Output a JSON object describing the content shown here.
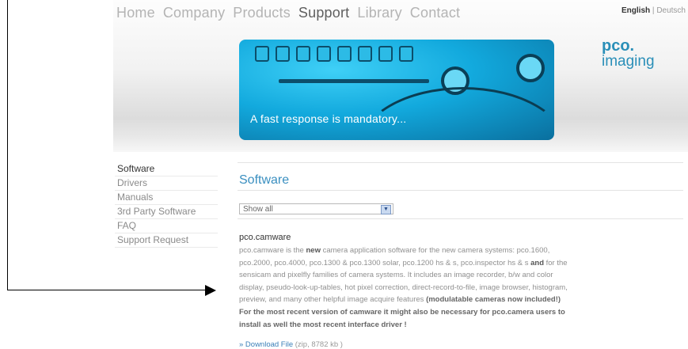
{
  "nav": {
    "items": [
      "Home",
      "Company",
      "Products",
      "Support",
      "Library",
      "Contact"
    ],
    "active": "Support"
  },
  "lang": {
    "english": "English",
    "separator": "|",
    "deutsch": "Deutsch"
  },
  "logo": {
    "line1": "pco.",
    "line2": "imaging"
  },
  "banner": {
    "caption": "A fast response is mandatory..."
  },
  "sidebar": {
    "items": [
      {
        "label": "Software",
        "active": true
      },
      {
        "label": "Drivers"
      },
      {
        "label": "Manuals"
      },
      {
        "label": "3rd Party Software"
      },
      {
        "label": "FAQ"
      },
      {
        "label": "Support Request"
      }
    ]
  },
  "main": {
    "title": "Software",
    "filter": {
      "selected": "Show all"
    },
    "product": {
      "name": "pco.camware",
      "desc": {
        "p1": "pco.camware is the ",
        "p1_bold": "new",
        "p2": " camera application software for the new camera systems: pco.1600, pco.2000, pco.4000, pco.1300 & pco.1300 solar, pco.1200 hs & s, pco.inspector hs & s ",
        "p2_bold": "and",
        "p3": " for the sensicam and pixelfly families of camera systems. It includes an image recorder, b/w and color display, pseudo-look-up-tables, hot pixel correction, direct-record-to-file, image browser, histogram, preview, and many other helpful image acquire features ",
        "p3_bold": "(modulatable cameras now included!)",
        "note": "For the most recent version of camware it might also be necessary for pco.camera users to install as well the most recent interface driver !"
      },
      "download": {
        "label": "» Download File",
        "meta": "(zip, 8782 kb )"
      }
    }
  },
  "colors": {
    "accent": "#3a8fc0",
    "logo": "#2a8fb8",
    "banner": "#12a9dd"
  }
}
